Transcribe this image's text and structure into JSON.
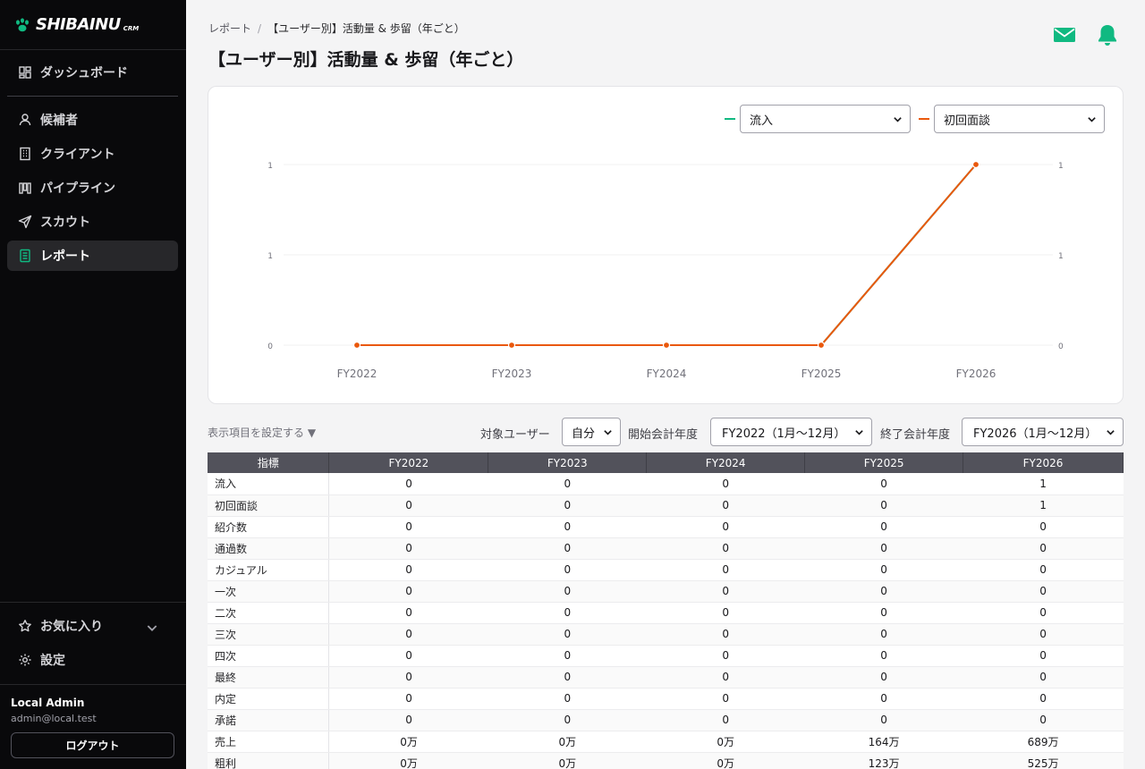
{
  "app": {
    "brand": "SHIBAINU",
    "brand_sub": "CRM"
  },
  "sidebar": {
    "items": [
      {
        "label": "ダッシュボード",
        "icon": "dashboard-icon"
      },
      {
        "label": "候補者",
        "icon": "user-icon"
      },
      {
        "label": "クライアント",
        "icon": "building-icon"
      },
      {
        "label": "パイプライン",
        "icon": "pipeline-icon"
      },
      {
        "label": "スカウト",
        "icon": "send-icon"
      },
      {
        "label": "レポート",
        "icon": "report-icon",
        "active": true
      }
    ],
    "favorites": "お気に入り",
    "settings": "設定"
  },
  "user": {
    "name": "Local Admin",
    "email": "admin@local.test",
    "logout": "ログアウト"
  },
  "breadcrumb": {
    "root": "レポート",
    "sep": "/",
    "current": "【ユーザー別】活動量 & 歩留（年ごと）"
  },
  "page": {
    "title": "【ユーザー別】活動量 & 歩留（年ごと）"
  },
  "colors": {
    "accent": "#10b981",
    "series1": "#10b981",
    "series2": "#ea580c"
  },
  "chart_controls": {
    "left_metric": "流入",
    "right_metric": "初回面談"
  },
  "chart_data": {
    "type": "line",
    "categories": [
      "FY2022",
      "FY2023",
      "FY2024",
      "FY2025",
      "FY2026"
    ],
    "series": [
      {
        "name": "流入",
        "axis": "left",
        "values": [
          0,
          0,
          0,
          0,
          1
        ]
      },
      {
        "name": "初回面談",
        "axis": "right",
        "values": [
          0,
          0,
          0,
          0,
          1
        ]
      }
    ],
    "y_left_ticks": [
      "0",
      "1",
      "1"
    ],
    "y_right_ticks": [
      "0",
      "1",
      "1"
    ],
    "ylim": [
      0,
      1
    ],
    "grid": true
  },
  "filters": {
    "display_items": "表示項目を設定する ▼",
    "target_user_label": "対象ユーザー",
    "target_user_value": "自分",
    "start_label": "開始会計年度",
    "start_value": "FY2022（1月〜12月）",
    "end_label": "終了会計年度",
    "end_value": "FY2026（1月〜12月）"
  },
  "table": {
    "headers": [
      "指標",
      "FY2022",
      "FY2023",
      "FY2024",
      "FY2025",
      "FY2026"
    ],
    "rows": [
      [
        "流入",
        "0",
        "0",
        "0",
        "0",
        "1"
      ],
      [
        "初回面談",
        "0",
        "0",
        "0",
        "0",
        "1"
      ],
      [
        "紹介数",
        "0",
        "0",
        "0",
        "0",
        "0"
      ],
      [
        "通過数",
        "0",
        "0",
        "0",
        "0",
        "0"
      ],
      [
        "カジュアル",
        "0",
        "0",
        "0",
        "0",
        "0"
      ],
      [
        "一次",
        "0",
        "0",
        "0",
        "0",
        "0"
      ],
      [
        "二次",
        "0",
        "0",
        "0",
        "0",
        "0"
      ],
      [
        "三次",
        "0",
        "0",
        "0",
        "0",
        "0"
      ],
      [
        "四次",
        "0",
        "0",
        "0",
        "0",
        "0"
      ],
      [
        "最終",
        "0",
        "0",
        "0",
        "0",
        "0"
      ],
      [
        "内定",
        "0",
        "0",
        "0",
        "0",
        "0"
      ],
      [
        "承諾",
        "0",
        "0",
        "0",
        "0",
        "0"
      ],
      [
        "売上",
        "0万",
        "0万",
        "0万",
        "164万",
        "689万"
      ],
      [
        "粗利",
        "0万",
        "0万",
        "0万",
        "123万",
        "525万"
      ]
    ]
  }
}
